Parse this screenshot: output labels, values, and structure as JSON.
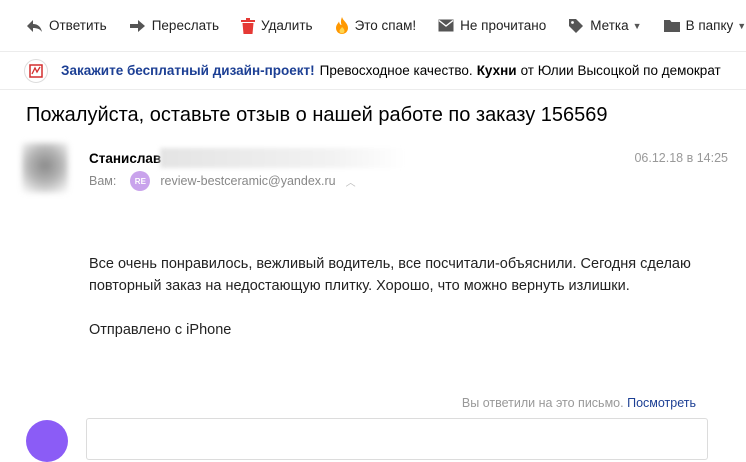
{
  "toolbar": {
    "reply": "Ответить",
    "forward": "Переслать",
    "delete": "Удалить",
    "spam": "Это спам!",
    "unread": "Не прочитано",
    "label": "Метка",
    "folder": "В папку"
  },
  "ad": {
    "link": "Закажите бесплатный дизайн-проект!",
    "text1": "Превосходное качество.",
    "bold": "Кухни",
    "text2": "от Юлии Высоцкой по демократ"
  },
  "message": {
    "subject": "Пожалуйста, оставьте отзыв о нашей работе по заказу 156569",
    "sender_name": "Станислав",
    "date": "06.12.18 в 14:25",
    "to_label": "Вам:",
    "to_badge": "RE",
    "to_email": "review-bestceramic@yandex.ru",
    "body_line1": "Все очень понравилось, вежливый водитель, все посчитали-объяснили. Сегодня сделаю",
    "body_line2": "повторный заказ на недостающую плитку. Хорошо, что можно вернуть излишки.",
    "signature": "Отправлено с iPhone"
  },
  "reply_notice": {
    "text": "Вы ответили на это письмо.",
    "link": "Посмотреть"
  },
  "colors": {
    "link": "#1c3f94",
    "delete_icon": "#e53935",
    "spam_icon": "#ff9800",
    "badge": "#c9a3ec",
    "avatar": "#8b5cf6"
  }
}
